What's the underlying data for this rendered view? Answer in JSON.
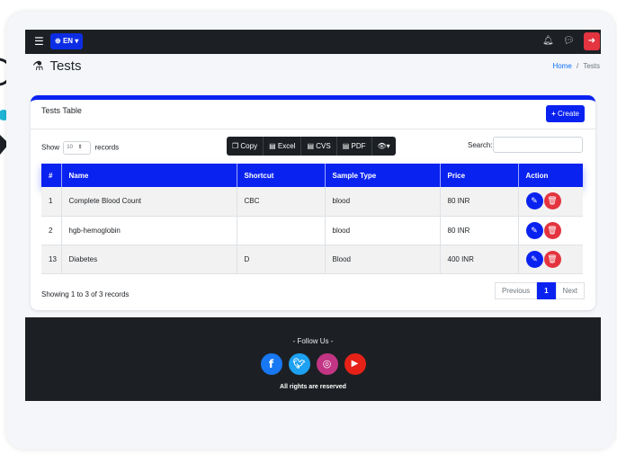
{
  "topbar": {
    "menu_icon": "hamburger-icon",
    "language": "EN",
    "icons": [
      "bell-icon",
      "chat-icon",
      "logout-icon"
    ]
  },
  "page": {
    "title": "Tests",
    "breadcrumb": {
      "home": "Home",
      "separator": "/",
      "current": "Tests"
    }
  },
  "card": {
    "title": "Tests Table",
    "create_label": "Create",
    "show_label": "Show",
    "page_length": "10",
    "records_label": "records",
    "export_buttons": [
      "Copy",
      "Excel",
      "CVS",
      "PDF"
    ],
    "search_label": "Search:",
    "search_value": ""
  },
  "table": {
    "columns": [
      "#",
      "Name",
      "Shortcut",
      "Sample Type",
      "Price",
      "Action"
    ],
    "rows": [
      {
        "id": "1",
        "name": "Complete Blood Count",
        "shortcut": "CBC",
        "sample_type": "blood",
        "price": "80 INR"
      },
      {
        "id": "2",
        "name": "hgb-hemoglobin",
        "shortcut": "",
        "sample_type": "blood",
        "price": "80 INR"
      },
      {
        "id": "13",
        "name": "Diabetes",
        "shortcut": "D",
        "sample_type": "Blood",
        "price": "400 INR"
      }
    ]
  },
  "pagination": {
    "info": "Showing 1 to 3 of 3 records",
    "previous": "Previous",
    "current": "1",
    "next": "Next"
  },
  "footer": {
    "follow": "- Follow Us -",
    "socials": [
      "facebook-icon",
      "twitter-icon",
      "instagram-icon",
      "youtube-icon"
    ],
    "rights": "All rights are reserved"
  },
  "colors": {
    "primary": "#0a22f0",
    "danger": "#e3343f",
    "dark": "#1c2024",
    "page_bg": "#f4f6f9"
  }
}
